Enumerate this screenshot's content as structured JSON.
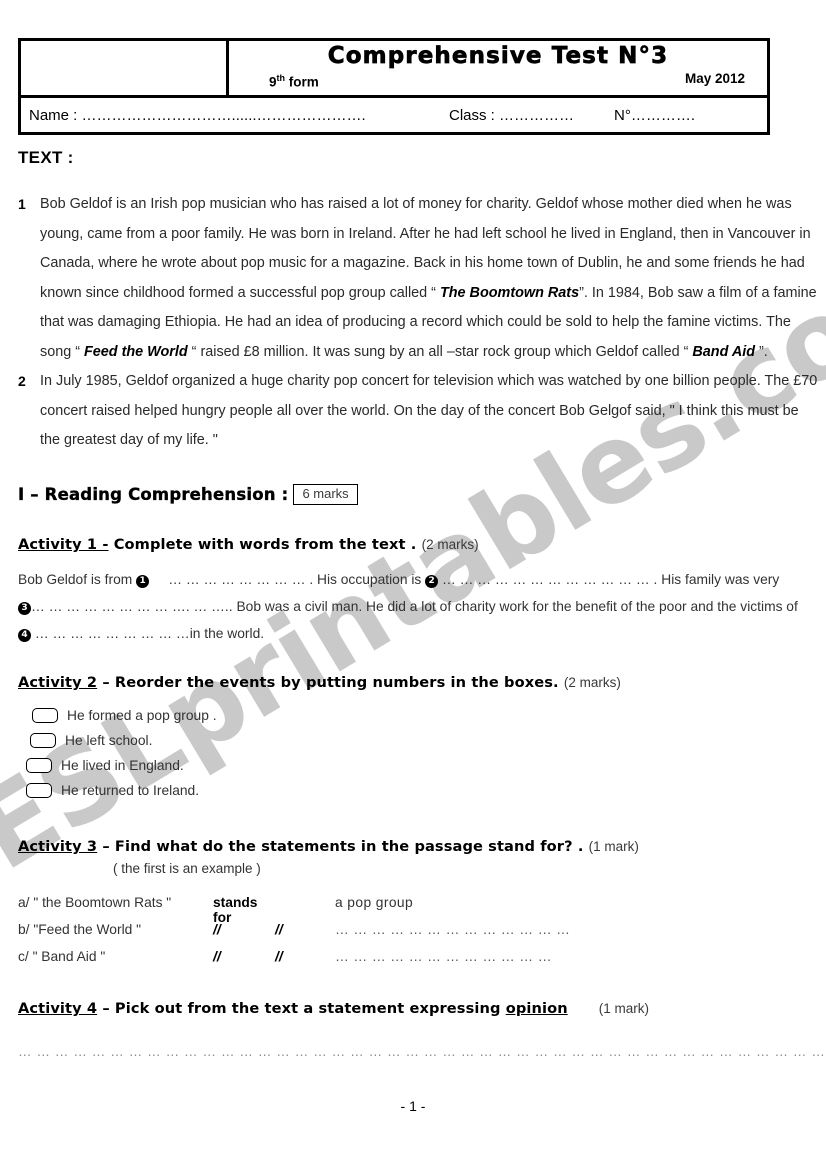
{
  "header": {
    "title": "Comprehensive Test N°3",
    "form": "9",
    "form_sup": "th",
    "form_word": "form",
    "date": "May 2012",
    "name_label": "Name :",
    "name_dots": "…………………………......………………….",
    "class_label": "Class :",
    "class_dots": "……………",
    "num_label": "N°",
    "num_dots": "…………."
  },
  "text_label": "TEXT :",
  "passage": {
    "paragraphs": [
      {
        "number": "1",
        "parts": [
          {
            "style": "normal",
            "text": "Bob Geldof is an Irish pop musician who has raised a lot of money for charity. Geldof whose mother died when he was young, came from a poor family. He was born in Ireland. After he had left school he lived in England, then in Vancouver in Canada, where he wrote about pop music for a magazine. Back in his home town of Dublin, he and some friends he had known since childhood formed a successful pop group called “ "
          },
          {
            "style": "bolditalic",
            "text": "The Boomtown Rats"
          },
          {
            "style": "normal",
            "text": "”. In 1984, Bob saw a film of a famine that was damaging Ethiopia. He had an idea of producing a record which could be sold to help the famine victims. The song “ "
          },
          {
            "style": "bolditalic",
            "text": "Feed the World"
          },
          {
            "style": "normal",
            "text": " “ raised £8 million. It was sung by an all –star rock group which Geldof called “ "
          },
          {
            "style": "bolditalic",
            "text": "Band Aid"
          },
          {
            "style": "normal",
            "text": " ”."
          }
        ]
      },
      {
        "number": "2",
        "parts": [
          {
            "style": "normal",
            "text": "In July 1985, Geldof organized a huge charity pop concert for television which was watched by one billion people. The £70 concert raised helped hungry people all over the world. On the day of the concert Bob Gelgof said, \" I think this must be the greatest day of my life. \""
          }
        ]
      }
    ]
  },
  "section": {
    "title": "I – Reading Comprehension :",
    "marks": "6 marks"
  },
  "activity1": {
    "number": "Activity 1 -",
    "instruction": "Complete with words from the text .",
    "marks": "(2 marks)",
    "line1_a": "Bob   Geldof is from",
    "bullet1": "1",
    "dots1": "… … … … … … … … .",
    "line1_b": "His occupation is",
    "bullet2": "2",
    "dots2": "… … … … … … … … … … … … .",
    "line1_c": "His family was very",
    "bullet3": "3",
    "dots3": "… … … … … … … … …. … …..",
    "line2": "Bob was a civil man. He did a lot of charity work for the benefit of the poor and the victims of",
    "bullet4": "4",
    "dots4": "… … … … … … … … …",
    "line3": "in the world."
  },
  "activity2": {
    "number": "Activity 2",
    "instruction": "– Reorder the events by putting numbers in the boxes.",
    "marks": "(2 marks)",
    "items": [
      "He formed a pop group .",
      "He left school.",
      "He lived in England.",
      "He returned to Ireland."
    ]
  },
  "activity3": {
    "number": "Activity 3",
    "instruction": "– Find what do the statements in the passage stand for? .",
    "marks": "(1 mark)",
    "note": "( the first is an example )",
    "rows": [
      {
        "label": "a/ \" the Boomtown Rats \"",
        "mid1": "stands for",
        "mid2": "",
        "answer": "a pop group",
        "is_example": true
      },
      {
        "label": "b/  \"Feed the World \"",
        "mid1": "//",
        "mid2": "//",
        "answer": "… … … … … … … … … … … … …",
        "is_example": false
      },
      {
        "label": "c/ \" Band Aid \"",
        "mid1": "//",
        "mid2": "//",
        "answer": "… … … … … … … … … … … …",
        "is_example": false
      }
    ]
  },
  "activity4": {
    "number": "Activity 4",
    "instruction_a": "– Pick out from the text a statement expressing",
    "instruction_underlined": "opinion",
    "marks": "(1 mark)",
    "answer_line": "… … … … … … … … … … … … … … … … … … … … … … … … … … … … … … … … … … … … … … … … … … … …"
  },
  "footer": {
    "page": "- 1 -"
  },
  "watermark": {
    "text": "ESLprintables.com",
    "color": "#c9c9c9"
  }
}
